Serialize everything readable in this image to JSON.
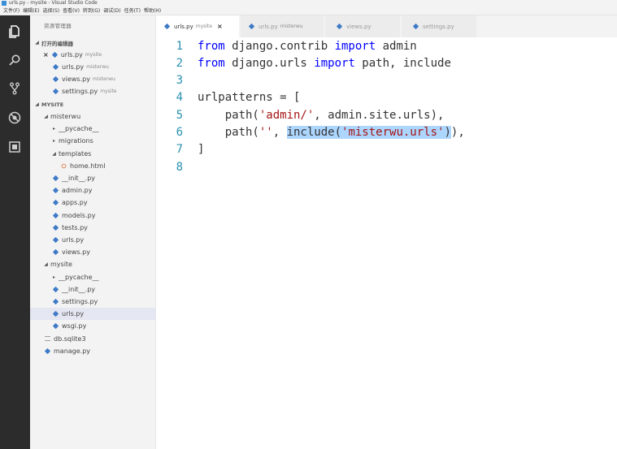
{
  "window": {
    "title": "urls.py - mysite - Visual Studio Code"
  },
  "menu": [
    "文件(F)",
    "编辑(E)",
    "选择(S)",
    "查看(V)",
    "转到(G)",
    "调试(D)",
    "任务(T)",
    "帮助(H)"
  ],
  "activity_icons": [
    "files-icon",
    "search-icon",
    "source-control-icon",
    "debug-icon",
    "extensions-icon"
  ],
  "sidebar": {
    "title": "资源管理器",
    "open_editors_header": "打开的编辑器",
    "open_editors": [
      {
        "name": "urls.py",
        "desc": "mysite",
        "active": true
      },
      {
        "name": "urls.py",
        "desc": "misterwu"
      },
      {
        "name": "views.py",
        "desc": "misterwu"
      },
      {
        "name": "settings.py",
        "desc": "mysite"
      }
    ],
    "project_header": "MYSITE",
    "tree": [
      {
        "label": "misterwu",
        "type": "folder-open",
        "depth": 1
      },
      {
        "label": "__pycache__",
        "type": "folder-closed",
        "depth": 2
      },
      {
        "label": "migrations",
        "type": "folder-closed",
        "depth": 2
      },
      {
        "label": "templates",
        "type": "folder-open",
        "depth": 2
      },
      {
        "label": "home.html",
        "type": "html",
        "depth": 3
      },
      {
        "label": "__init__.py",
        "type": "py",
        "depth": 2
      },
      {
        "label": "admin.py",
        "type": "py",
        "depth": 2
      },
      {
        "label": "apps.py",
        "type": "py",
        "depth": 2
      },
      {
        "label": "models.py",
        "type": "py",
        "depth": 2
      },
      {
        "label": "tests.py",
        "type": "py",
        "depth": 2
      },
      {
        "label": "urls.py",
        "type": "py",
        "depth": 2
      },
      {
        "label": "views.py",
        "type": "py",
        "depth": 2
      },
      {
        "label": "mysite",
        "type": "folder-open",
        "depth": 1
      },
      {
        "label": "__pycache__",
        "type": "folder-closed",
        "depth": 2
      },
      {
        "label": "__init__.py",
        "type": "py",
        "depth": 2
      },
      {
        "label": "settings.py",
        "type": "py",
        "depth": 2
      },
      {
        "label": "urls.py",
        "type": "py",
        "depth": 2,
        "selected": true
      },
      {
        "label": "wsgi.py",
        "type": "py",
        "depth": 2
      },
      {
        "label": "db.sqlite3",
        "type": "db",
        "depth": 1
      },
      {
        "label": "manage.py",
        "type": "py",
        "depth": 1
      }
    ]
  },
  "tabs": [
    {
      "name": "urls.py",
      "desc": "mysite",
      "active": true,
      "close": "×"
    },
    {
      "name": "urls.py",
      "desc": "misterwu"
    },
    {
      "name": "views.py",
      "desc": ""
    },
    {
      "name": "settings.py",
      "desc": ""
    }
  ],
  "editor": {
    "lines": [
      {
        "num": "1",
        "tokens": [
          {
            "t": "from",
            "c": "kw"
          },
          {
            "t": " django.contrib "
          },
          {
            "t": "import",
            "c": "kw"
          },
          {
            "t": " admin"
          }
        ]
      },
      {
        "num": "2",
        "tokens": [
          {
            "t": "from",
            "c": "kw"
          },
          {
            "t": " django.urls "
          },
          {
            "t": "import",
            "c": "kw"
          },
          {
            "t": " path, include"
          }
        ]
      },
      {
        "num": "3",
        "tokens": []
      },
      {
        "num": "4",
        "tokens": [
          {
            "t": "urlpatterns = ["
          }
        ]
      },
      {
        "num": "5",
        "tokens": [
          {
            "t": "    path("
          },
          {
            "t": "'admin/'",
            "c": "str"
          },
          {
            "t": ", admin.site.urls),"
          }
        ]
      },
      {
        "num": "6",
        "tokens": [
          {
            "t": "    path("
          },
          {
            "t": "''",
            "c": "str"
          },
          {
            "t": ", "
          },
          {
            "t": "include(",
            "h": true
          },
          {
            "t": "'misterwu.urls'",
            "c": "str",
            "h": true
          },
          {
            "t": ")",
            "h": true
          },
          {
            "t": "),"
          }
        ]
      },
      {
        "num": "7",
        "tokens": [
          {
            "t": "]"
          }
        ]
      },
      {
        "num": "8",
        "tokens": []
      }
    ]
  },
  "colors": {
    "accent": "#3f7ac7",
    "keyword": "#0000ff",
    "string": "#a31515",
    "line_number": "#2b91af",
    "selection": "#add6ff"
  }
}
